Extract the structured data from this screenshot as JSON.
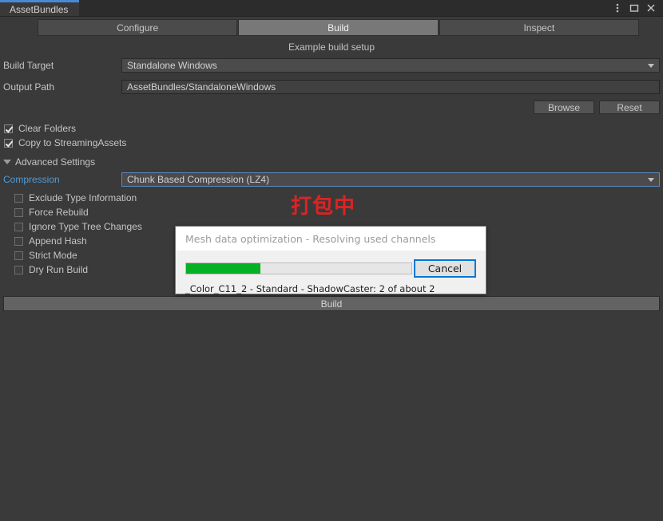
{
  "window": {
    "tab_label": "AssetBundles",
    "controls": [
      {
        "name": "kebab-menu-icon",
        "glyph": "⋮"
      },
      {
        "name": "maximize-icon",
        "glyph": "□"
      },
      {
        "name": "close-icon",
        "glyph": "✕"
      }
    ]
  },
  "toolbar": {
    "tabs": [
      {
        "label": "Configure",
        "active": false
      },
      {
        "label": "Build",
        "active": true
      },
      {
        "label": "Inspect",
        "active": false
      }
    ]
  },
  "main": {
    "subtitle": "Example build setup",
    "build_target": {
      "label": "Build Target",
      "value": "Standalone Windows"
    },
    "output_path": {
      "label": "Output Path",
      "value": "AssetBundles/StandaloneWindows"
    },
    "browse_label": "Browse",
    "reset_label": "Reset",
    "toggles": [
      {
        "label": "Clear Folders",
        "checked": true
      },
      {
        "label": "Copy to StreamingAssets",
        "checked": true
      }
    ],
    "advanced": {
      "label": "Advanced Settings",
      "expanded": true,
      "compression": {
        "label": "Compression",
        "value": "Chunk Based Compression (LZ4)"
      },
      "options": [
        {
          "label": "Exclude Type Information",
          "checked": false
        },
        {
          "label": "Force Rebuild",
          "checked": false
        },
        {
          "label": "Ignore Type Tree Changes",
          "checked": false
        },
        {
          "label": "Append Hash",
          "checked": false
        },
        {
          "label": "Strict Mode",
          "checked": false
        },
        {
          "label": "Dry Run Build",
          "checked": false
        }
      ]
    },
    "build_button_label": "Build"
  },
  "overlay": {
    "red_text": "打包中"
  },
  "dialog": {
    "title": "Mesh data optimization - Resolving used channels",
    "progress_percent": 33,
    "progress_width": "33%",
    "cancel_label": "Cancel",
    "status": "_Color_C11_2 - Standard - ShadowCaster: 2 of about 2"
  },
  "colors": {
    "accent_blue": "#4a88d6",
    "link_blue": "#4e9bd8",
    "progress_green": "#06b025",
    "focus_blue": "#0078d7",
    "alert_red": "#e02222",
    "window_bg": "#3a3a3a"
  }
}
